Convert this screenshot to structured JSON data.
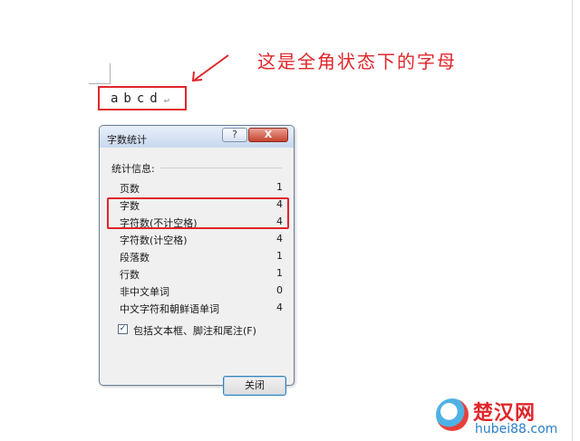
{
  "document": {
    "sample_text": "abcd",
    "para_mark": "↵",
    "annotation": "这是全角状态下的字母"
  },
  "dialog": {
    "title": "字数统计",
    "help_glyph": "?",
    "close_glyph": "X",
    "group_label": "统计信息:",
    "stats": [
      {
        "label": "页数",
        "value": "1"
      },
      {
        "label": "字数",
        "value": "4"
      },
      {
        "label": "字符数(不计空格)",
        "value": "4"
      },
      {
        "label": "字符数(计空格)",
        "value": "4"
      },
      {
        "label": "段落数",
        "value": "1"
      },
      {
        "label": "行数",
        "value": "1"
      },
      {
        "label": "非中文单词",
        "value": "0"
      },
      {
        "label": "中文字符和朝鲜语单词",
        "value": "4"
      }
    ],
    "checkbox_checked": true,
    "checkbox_glyph": "✓",
    "checkbox_label": "包括文本框、脚注和尾注(F)",
    "close_button": "关闭"
  },
  "watermark": {
    "name": "楚汉网",
    "url": "hubei88.com"
  },
  "colors": {
    "annotation_red": "#e0262a",
    "dialog_bg": "#f0f0f0",
    "title_bar": "#c8d8ee"
  }
}
